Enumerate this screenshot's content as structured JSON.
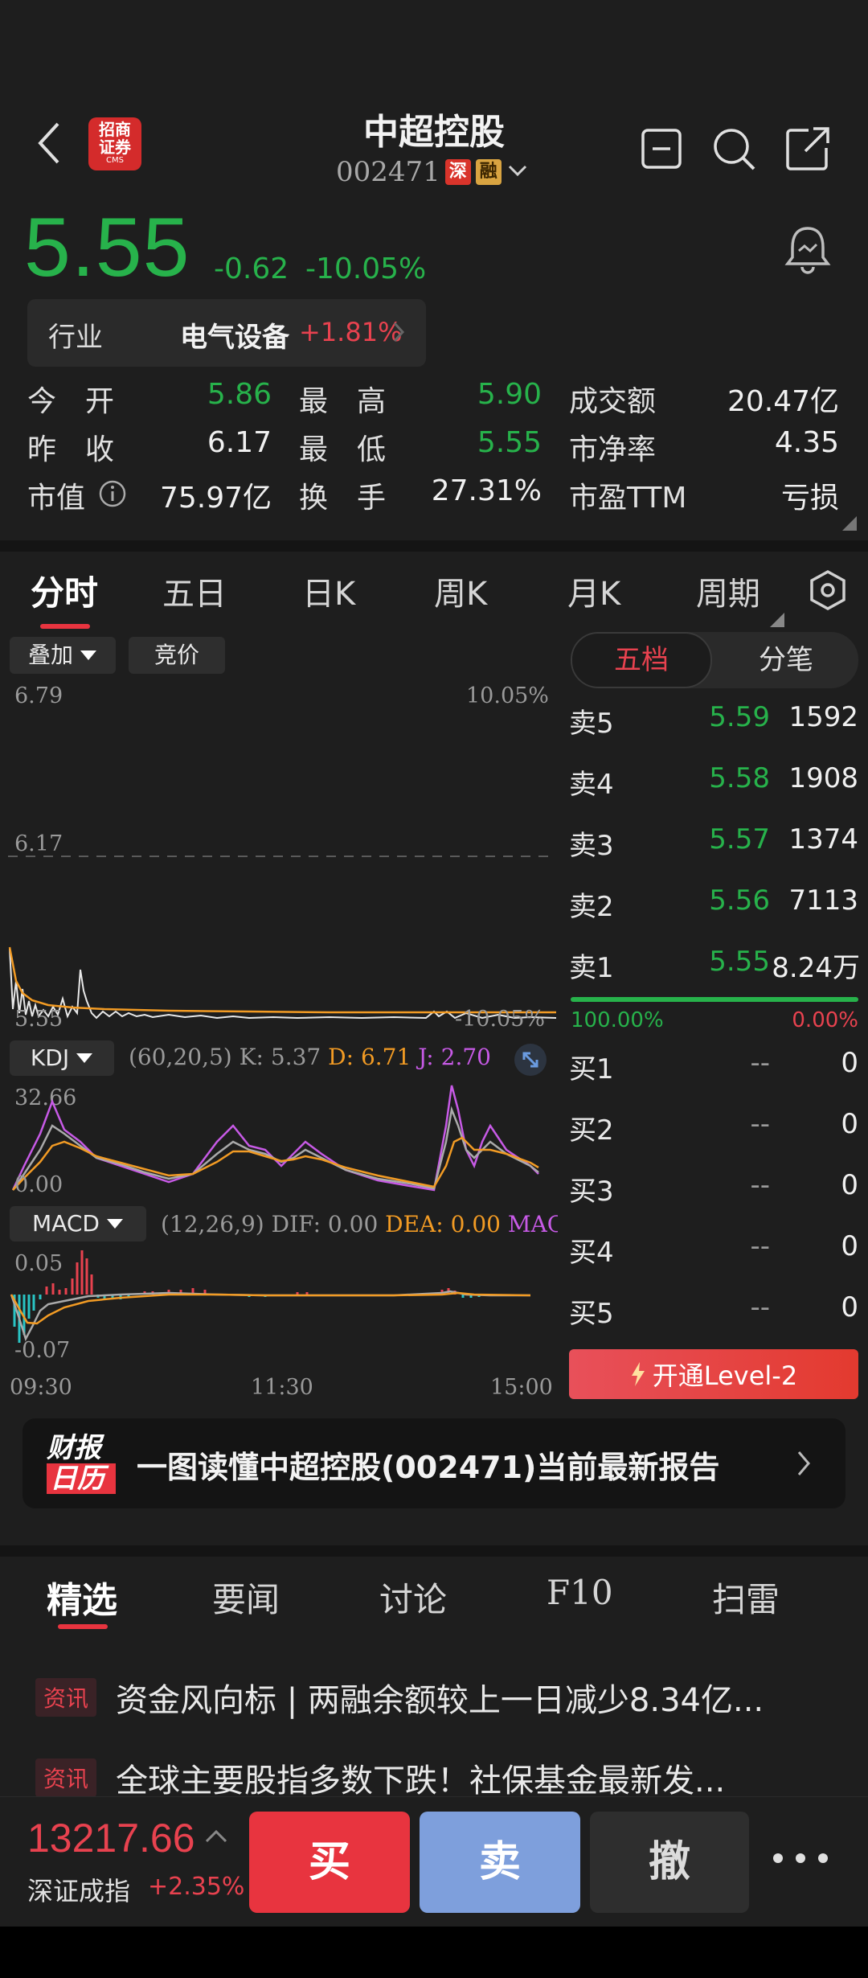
{
  "header": {
    "title": "中超控股",
    "code": "002471",
    "tag_shen": "深",
    "tag_rong": "融",
    "broker_logo_line1": "招商",
    "broker_logo_line2": "证券",
    "broker_logo_sub": "CMS"
  },
  "quote": {
    "price": "5.55",
    "change": "-0.62",
    "change_pct": "-10.05%",
    "industry_label": "行业",
    "industry_name": "电气设备",
    "industry_pct": "+1.81%"
  },
  "stats": [
    {
      "label": "今　开",
      "value": "5.86",
      "color": "green"
    },
    {
      "label": "最　高",
      "value": "5.90",
      "color": "green"
    },
    {
      "label": "成交额",
      "value": "20.47亿",
      "color": "white"
    },
    {
      "label": "昨　收",
      "value": "6.17",
      "color": "white"
    },
    {
      "label": "最　低",
      "value": "5.55",
      "color": "green"
    },
    {
      "label": "市净率",
      "value": "4.35",
      "color": "white"
    },
    {
      "label": "市值",
      "value": "75.97亿",
      "color": "white"
    },
    {
      "label": "换　手",
      "value": "27.31%",
      "color": "white"
    },
    {
      "label": "市盈TTM",
      "value": "亏损",
      "color": "white"
    }
  ],
  "chart_tabs": [
    "分时",
    "五日",
    "日K",
    "周K",
    "月K",
    "周期"
  ],
  "chart_controls": {
    "overlay": "叠加",
    "auction": "竞价"
  },
  "intraday": {
    "y_top": "6.79",
    "y_mid": "6.17",
    "y_bottom": "5.55",
    "pct_top": "10.05%",
    "pct_bottom": "-10.05%",
    "x_labels": [
      "09:30",
      "11:30",
      "15:00"
    ]
  },
  "kdj": {
    "name": "KDJ",
    "params": "(60,20,5)",
    "k": "K: 5.37",
    "d": "D: 6.71",
    "j": "J: 2.70",
    "y_top": "32.66",
    "y_bottom": "0.00"
  },
  "macd": {
    "name": "MACD",
    "params": "(12,26,9)",
    "dif": "DIF: 0.00",
    "dea": "DEA: 0.00",
    "mac": "MAC",
    "y_top": "0.05",
    "y_bottom": "-0.07"
  },
  "orderbook": {
    "tab_five": "五档",
    "tab_detail": "分笔",
    "asks": [
      {
        "label": "卖5",
        "price": "5.59",
        "vol": "1592"
      },
      {
        "label": "卖4",
        "price": "5.58",
        "vol": "1908"
      },
      {
        "label": "卖3",
        "price": "5.57",
        "vol": "1374"
      },
      {
        "label": "卖2",
        "price": "5.56",
        "vol": "7113"
      },
      {
        "label": "卖1",
        "price": "5.55",
        "vol": "8.24万"
      }
    ],
    "ratio_left": "100.00%",
    "ratio_right": "0.00%",
    "bids": [
      {
        "label": "买1",
        "price": "--",
        "vol": "0"
      },
      {
        "label": "买2",
        "price": "--",
        "vol": "0"
      },
      {
        "label": "买3",
        "price": "--",
        "vol": "0"
      },
      {
        "label": "买4",
        "price": "--",
        "vol": "0"
      },
      {
        "label": "买5",
        "price": "--",
        "vol": "0"
      }
    ],
    "level2_btn": "开通Level-2"
  },
  "banner": {
    "logo_line1": "财报",
    "logo_line2": "日历",
    "text": "一图读懂中超控股(002471)当前最新报告"
  },
  "news_tabs": [
    "精选",
    "要闻",
    "讨论",
    "F10",
    "扫雷"
  ],
  "news": [
    {
      "tag": "资讯",
      "text": "资金风向标 | 两融余额较上一日减少8.34亿..."
    },
    {
      "tag": "资讯",
      "text": "全球主要股指多数下跌！社保基金最新发..."
    }
  ],
  "bottom": {
    "index_value": "13217.66",
    "index_name": "深证成指",
    "index_pct": "+2.35%",
    "buy": "买",
    "sell": "卖",
    "cancel": "撤"
  },
  "colors": {
    "green": "#27b24b",
    "red": "#e8424f",
    "background": "#1e1e1e",
    "orange": "#f29b24",
    "purple": "#c75ae6"
  }
}
